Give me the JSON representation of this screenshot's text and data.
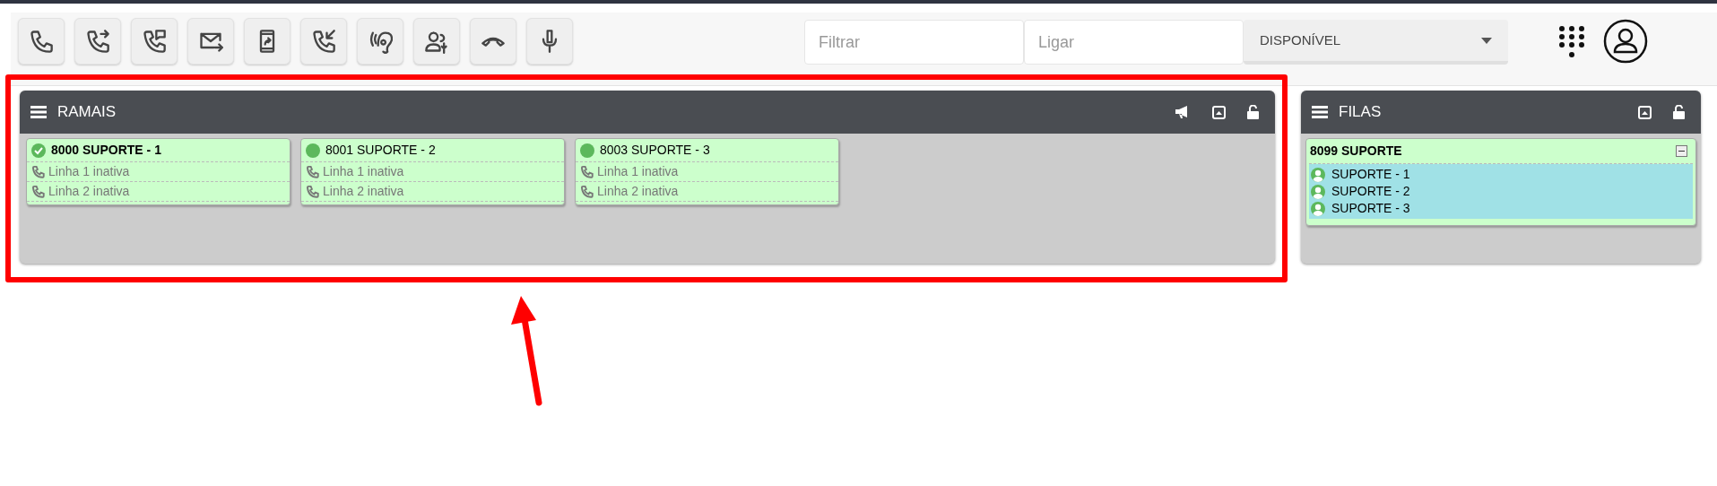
{
  "toolbar": {
    "filter": {
      "placeholder": "Filtrar"
    },
    "dial": {
      "placeholder": "Ligar"
    },
    "status_select": {
      "value": "DISPONÍVEL"
    }
  },
  "ramais": {
    "title": "RAMAIS",
    "extensions": [
      {
        "name": "8000 SUPORTE - 1",
        "current": true,
        "lines": [
          "Linha 1 inativa",
          "Linha 2 inativa"
        ]
      },
      {
        "name": "8001 SUPORTE - 2",
        "current": false,
        "lines": [
          "Linha 1 inativa",
          "Linha 2 inativa"
        ]
      },
      {
        "name": "8003 SUPORTE - 3",
        "current": false,
        "lines": [
          "Linha 1 inativa",
          "Linha 2 inativa"
        ]
      }
    ]
  },
  "filas": {
    "title": "FILAS",
    "queues": [
      {
        "name": "8099 SUPORTE",
        "expanded": true,
        "members": [
          "SUPORTE - 1",
          "SUPORTE - 2",
          "SUPORTE - 3"
        ]
      }
    ]
  }
}
